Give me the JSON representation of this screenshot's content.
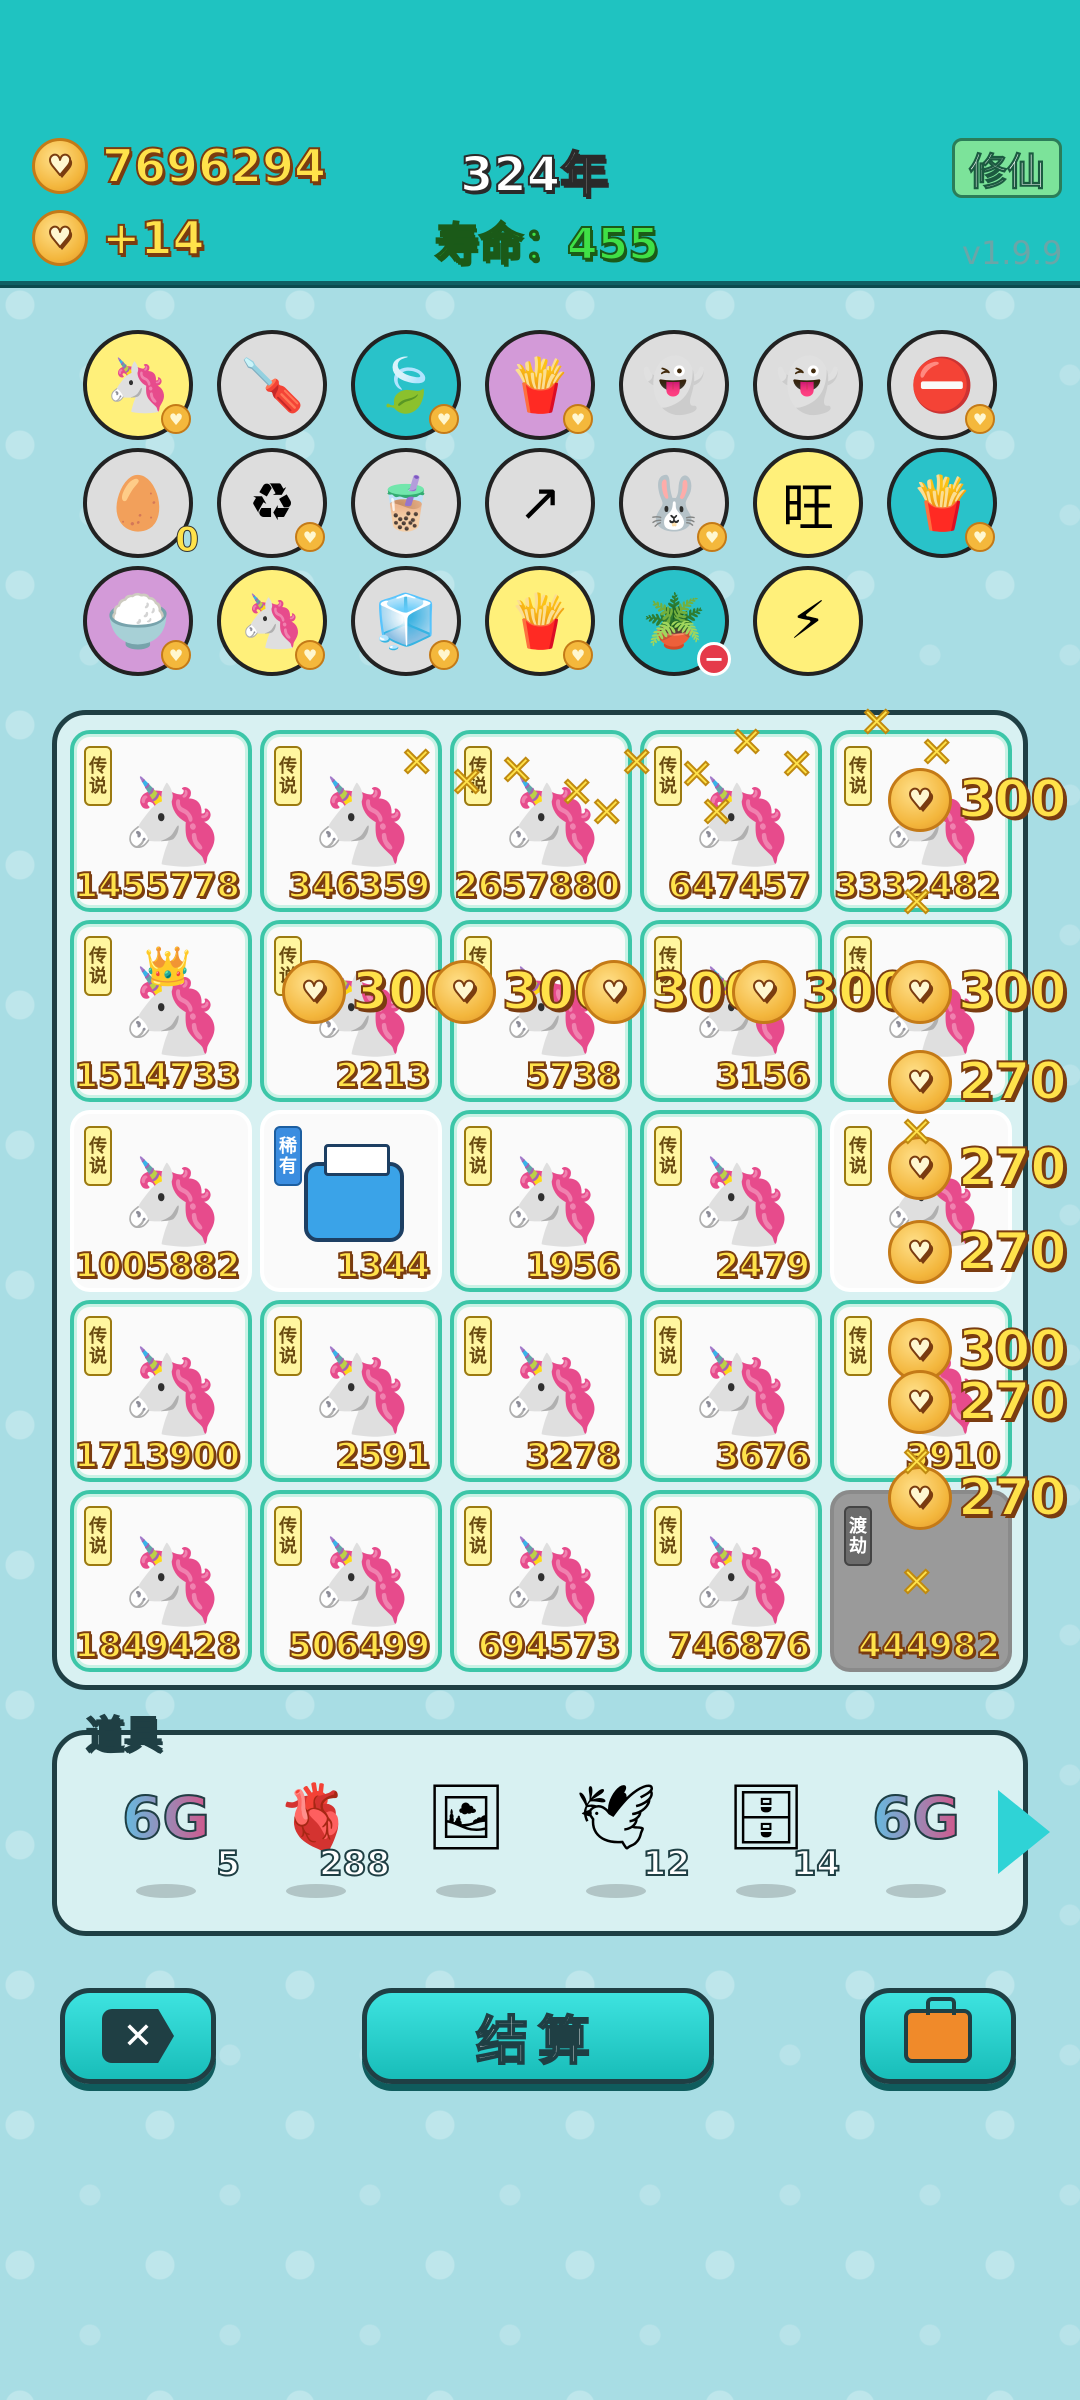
{
  "header": {
    "coins": "7696294",
    "income": "+14",
    "year": "324年",
    "lifespan": "寿命：455",
    "xiuxian_label": "修仙",
    "version": "v1.9.9"
  },
  "relics": [
    {
      "icon": "unicorn-icon",
      "glyph": "🦄"
    },
    {
      "icon": "screwdriver-icon",
      "glyph": "🪛"
    },
    {
      "icon": "leaf-icon",
      "glyph": "🍃"
    },
    {
      "icon": "fries-icon",
      "glyph": "🍟"
    },
    {
      "icon": "ghost-icon",
      "glyph": "👻"
    },
    {
      "icon": "ghost-wink-icon",
      "glyph": "👻"
    },
    {
      "icon": "no-entry-icon",
      "glyph": "⛔"
    },
    {
      "icon": "egg-tray-icon",
      "glyph": "🥚",
      "count": "0"
    },
    {
      "icon": "recycle-icon",
      "glyph": "♻"
    },
    {
      "icon": "milk-tea-icon",
      "glyph": "🧋"
    },
    {
      "icon": "arrow-box-icon",
      "glyph": "↗"
    },
    {
      "icon": "rabbit-icon",
      "glyph": "🐰"
    },
    {
      "icon": "wang-icon",
      "glyph": "旺"
    },
    {
      "icon": "fries-icon-2",
      "glyph": "🍟"
    },
    {
      "icon": "rice-bowl-icon",
      "glyph": "🍚"
    },
    {
      "icon": "unicorn-icon-2",
      "glyph": "🦄"
    },
    {
      "icon": "sugar-cubes-icon",
      "glyph": "🧊"
    },
    {
      "icon": "fries-icon-3",
      "glyph": "🍟"
    },
    {
      "icon": "flower-pot-icon",
      "glyph": "🪴"
    },
    {
      "icon": "lightning-icon",
      "glyph": "⚡"
    }
  ],
  "grid": {
    "tag_legend": "传说",
    "tag_rare": "稀有",
    "tag_dujie": "渡劫",
    "cells": [
      {
        "value": "1455778",
        "tag": "传说"
      },
      {
        "value": "346359",
        "tag": "传说"
      },
      {
        "value": "2657880",
        "tag": "传说"
      },
      {
        "value": "647457",
        "tag": "传说"
      },
      {
        "value": "3332482",
        "tag": "传说"
      },
      {
        "value": "1514733",
        "tag": "传说"
      },
      {
        "value": "2213",
        "tag": "传说"
      },
      {
        "value": "5738",
        "tag": "传说"
      },
      {
        "value": "3156",
        "tag": "传说"
      },
      {
        "value": "",
        "tag": "传说"
      },
      {
        "value": "1005882",
        "tag": "传说"
      },
      {
        "value": "1344",
        "tag": "稀有"
      },
      {
        "value": "1956",
        "tag": "传说"
      },
      {
        "value": "2479",
        "tag": "传说"
      },
      {
        "value": "",
        "tag": "传说"
      },
      {
        "value": "1713900",
        "tag": "传说"
      },
      {
        "value": "2591",
        "tag": "传说"
      },
      {
        "value": "3278",
        "tag": "传说"
      },
      {
        "value": "3676",
        "tag": "传说"
      },
      {
        "value": "3910",
        "tag": "传说"
      },
      {
        "value": "1849428",
        "tag": "传说"
      },
      {
        "value": "506499",
        "tag": "传说"
      },
      {
        "value": "694573",
        "tag": "传说"
      },
      {
        "value": "746876",
        "tag": "传说"
      },
      {
        "value": "444982",
        "tag": "渡劫"
      }
    ]
  },
  "effects": [
    {
      "text": "300"
    },
    {
      "text": "300"
    },
    {
      "text": "300"
    },
    {
      "text": "300"
    },
    {
      "text": "300"
    },
    {
      "text": "300"
    },
    {
      "text": "270"
    },
    {
      "text": "270"
    },
    {
      "text": "270"
    },
    {
      "text": "300"
    },
    {
      "text": "270"
    },
    {
      "text": "270"
    }
  ],
  "items_panel": {
    "title": "道具",
    "items": [
      {
        "icon": "6g-icon",
        "label": "6G",
        "qty": "5"
      },
      {
        "icon": "liver-icon",
        "label": "",
        "qty": "288"
      },
      {
        "icon": "portrait-icon",
        "label": "",
        "qty": ""
      },
      {
        "icon": "pigeon-icon",
        "label": "",
        "qty": "12"
      },
      {
        "icon": "cabinet-icon",
        "label": "",
        "qty": "14"
      },
      {
        "icon": "6g-icon-2",
        "label": "6G",
        "qty": ""
      }
    ]
  },
  "buttons": {
    "settle": "结算"
  },
  "colors": {
    "topbar": "#1fc3c1",
    "background": "#a8dde4",
    "gold": "#ffe24a",
    "green": "#3fe046"
  }
}
